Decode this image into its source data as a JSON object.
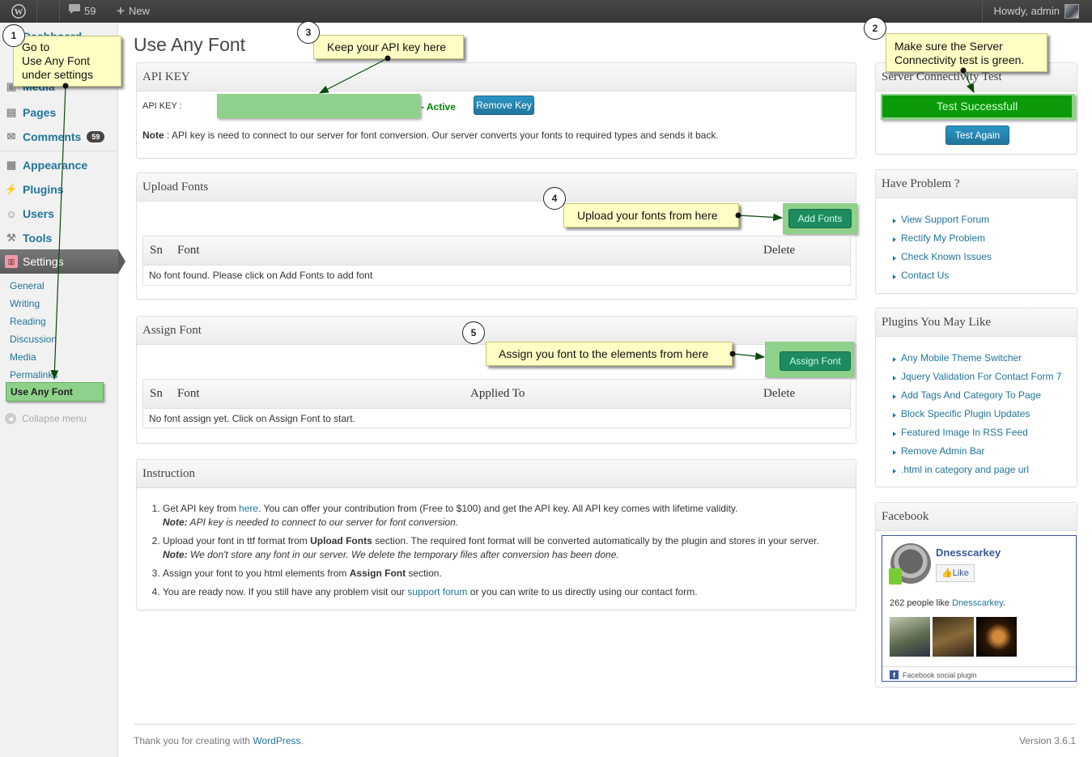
{
  "adminbar": {
    "comments_count": "59",
    "new_label": "New",
    "howdy": "Howdy, admin"
  },
  "sidebar": {
    "items": [
      {
        "label": "Dashboard",
        "icon": "dashboard-icon"
      },
      {
        "label": "Media",
        "icon": "media-icon"
      },
      {
        "label": "Pages",
        "icon": "pages-icon"
      },
      {
        "label": "Comments",
        "icon": "comments-icon",
        "badge": "59"
      },
      {
        "label": "Appearance",
        "icon": "appearance-icon"
      },
      {
        "label": "Plugins",
        "icon": "plugins-icon"
      },
      {
        "label": "Users",
        "icon": "users-icon"
      },
      {
        "label": "Tools",
        "icon": "tools-icon"
      },
      {
        "label": "Settings",
        "icon": "settings-icon"
      }
    ],
    "submenu": [
      "General",
      "Writing",
      "Reading",
      "Discussion",
      "Media",
      "Permalinks",
      "Use Any Font"
    ],
    "collapse": "Collapse menu"
  },
  "page": {
    "title": "Use Any Font"
  },
  "api": {
    "title": "API KEY",
    "field_label": "API KEY :",
    "status": "- Active",
    "remove_button": "Remove Key",
    "note_label": "Note",
    "note_text": ": API key is need to connect to our server for font conversion. Our server converts your fonts to required types and sends it back."
  },
  "upload": {
    "title": "Upload Fonts",
    "add_button": "Add Fonts",
    "columns": [
      "Sn",
      "Font",
      "Delete"
    ],
    "empty": "No font found. Please click on Add Fonts to add font"
  },
  "assign": {
    "title": "Assign Font",
    "assign_button": "Assign Font",
    "columns": [
      "Sn",
      "Font",
      "Applied To",
      "Delete"
    ],
    "empty": "No font assign yet. Click on Assign Font to start."
  },
  "instruction": {
    "title": "Instruction",
    "items": [
      {
        "pre": "Get API key from ",
        "link": "here",
        "post": ". You can offer your contribution from (Free to $100) and get the API key. All API key comes with lifetime validity.",
        "note_label": "Note:",
        "note": " API key is needed to connect to our server for font conversion."
      },
      {
        "pre": "Upload your font in ttf format from ",
        "bold": "Upload Fonts",
        "post": " section. The required font format will be converted automatically by the plugin and stores in your server.",
        "note_label": "Note:",
        "note": " We don't store any font in our server. We delete the temporary files after conversion has been done."
      },
      {
        "pre": "Assign your font to you html elements from ",
        "bold": "Assign Font",
        "post": " section."
      },
      {
        "pre": "You are ready now. If you still have any problem visit our ",
        "link": "support forum",
        "post": " or you can write to us directly using our contact form."
      }
    ]
  },
  "server_test": {
    "title": "Server Connectivity Test",
    "status_button": "Test Successfull",
    "again_button": "Test Again"
  },
  "problem": {
    "title": "Have Problem ?",
    "links": [
      "View Support Forum",
      "Rectify My Problem",
      "Check Known Issues",
      "Contact Us"
    ]
  },
  "plugins": {
    "title": "Plugins You May Like",
    "links": [
      "Any Mobile Theme Switcher",
      "Jquery Validation For Contact Form 7",
      "Add Tags And Category To Page",
      "Block Specific Plugin Updates",
      "Featured Image In RSS Feed",
      "Remove Admin Bar",
      ".html in category and page url"
    ]
  },
  "facebook": {
    "title": "Facebook",
    "page_name": "Dnesscarkey",
    "like_button": "Like",
    "likes_prefix": "262 people like ",
    "likes_link": "Dnesscarkey",
    "likes_suffix": ".",
    "social_plugin": "Facebook social plugin"
  },
  "footer": {
    "thanks_prefix": "Thank you for creating with ",
    "thanks_link": "WordPress",
    "thanks_suffix": ".",
    "version": "Version 3.6.1"
  },
  "callouts": {
    "c1": {
      "num": "1",
      "lines": [
        "Go to",
        "Use Any Font",
        "under settings"
      ]
    },
    "c2": {
      "num": "2",
      "lines": [
        "Make sure the Server",
        "Connectivity test is green."
      ]
    },
    "c3": {
      "num": "3",
      "text": "Keep your API key here"
    },
    "c4": {
      "num": "4",
      "text": "Upload your fonts from here"
    },
    "c5": {
      "num": "5",
      "text": "Assign you font to the elements from here"
    }
  },
  "colors": {
    "highlight_green": "#8ed18a",
    "callout_yellow": "#fffec4",
    "link_blue": "#21759b",
    "success_green": "#0a9a0a"
  }
}
